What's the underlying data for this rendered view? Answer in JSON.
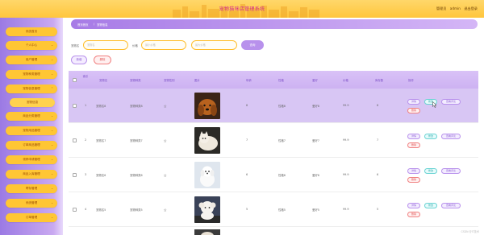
{
  "header": {
    "title": "宠物猫咪店管理系统",
    "admin_label": "管理员",
    "user": "admin",
    "logout": "退出登录"
  },
  "sidebar": {
    "items": [
      {
        "label": "系统首页"
      },
      {
        "label": "个人中心"
      },
      {
        "label": "用户管理"
      },
      {
        "label": "宠物种类管理"
      },
      {
        "label": "宠物信息管理"
      },
      {
        "label": "宠物信息"
      },
      {
        "label": "商品分类管理"
      },
      {
        "label": "宠物用品管理"
      },
      {
        "label": "订单商品管理"
      },
      {
        "label": "领养申请管理"
      },
      {
        "label": "商品入库管理"
      },
      {
        "label": "寄存管理"
      },
      {
        "label": "系统管理"
      },
      {
        "label": "订单管理"
      }
    ]
  },
  "breadcrumb": {
    "home": "首页首页",
    "current": "宠物信息"
  },
  "search": {
    "name_label": "宠物名",
    "name_placeholder": "宠物名",
    "price_label": "价格",
    "min_placeholder": "最小价格",
    "max_placeholder": "最大价格",
    "search_button": "查询"
  },
  "toolbar": {
    "add_label": "新增",
    "delete_label": "删除"
  },
  "table": {
    "headers": [
      "索引",
      "宠物名",
      "宠物种类",
      "宠物性别",
      "图片",
      "年龄",
      "性格",
      "爱好",
      "价格",
      "库存数",
      "操作"
    ],
    "rows": [
      {
        "idx": "1",
        "name": "宠物名8",
        "type": "宠物种类8",
        "gender": "公",
        "age": "8",
        "personality": "性格8",
        "hobby": "爱好8",
        "price": "99.9",
        "stock": "8"
      },
      {
        "idx": "2",
        "name": "宠物名7",
        "type": "宠物种类7",
        "gender": "公",
        "age": "7",
        "personality": "性格7",
        "hobby": "爱好7",
        "price": "99.9",
        "stock": "7"
      },
      {
        "idx": "3",
        "name": "宠物名6",
        "type": "宠物种类6",
        "gender": "公",
        "age": "6",
        "personality": "性格6",
        "hobby": "爱好6",
        "price": "99.9",
        "stock": "6"
      },
      {
        "idx": "4",
        "name": "宠物名5",
        "type": "宠物种类5",
        "gender": "公",
        "age": "5",
        "personality": "性格5",
        "hobby": "爱好5",
        "price": "99.9",
        "stock": "5"
      }
    ],
    "actions": {
      "detail": "详情",
      "edit": "修改",
      "review": "查看评论",
      "delete": "删除"
    }
  },
  "watermark": "CSDN @IT技术",
  "colors": {
    "header": "#ffc63d",
    "sidebar": "#b891ec",
    "accent": "#ffc634",
    "highlight_row": "#d8c6f4"
  }
}
